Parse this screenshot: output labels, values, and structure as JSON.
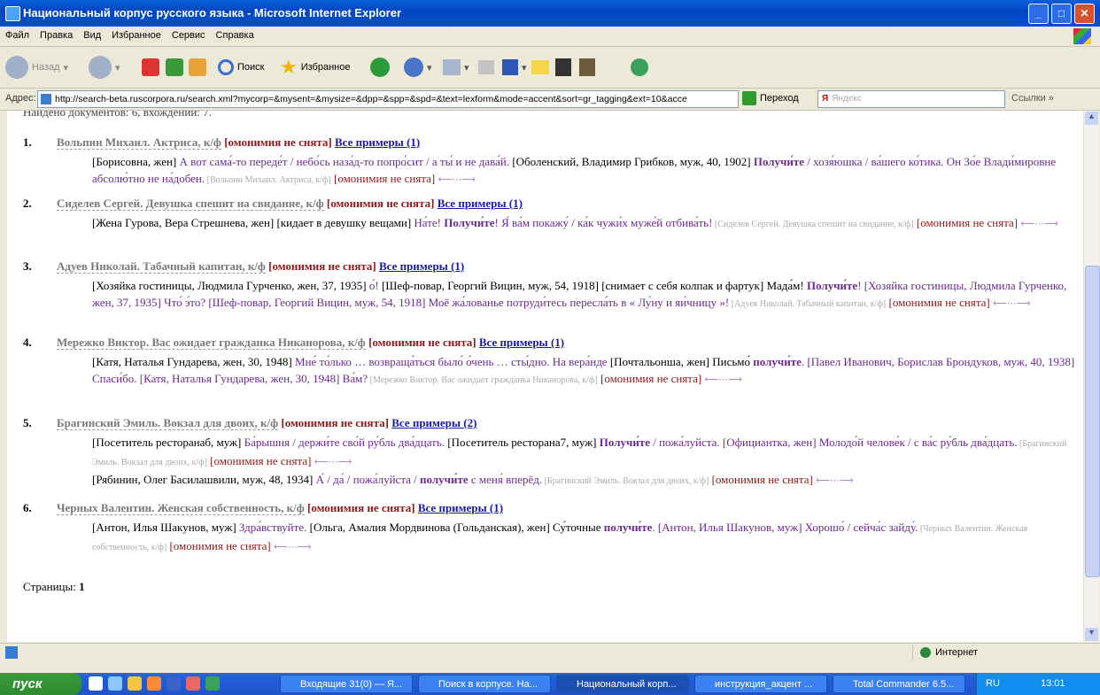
{
  "window": {
    "title": "Национальный корпус русского языка - Microsoft Internet Explorer"
  },
  "menu": [
    "Файл",
    "Правка",
    "Вид",
    "Избранное",
    "Сервис",
    "Справка"
  ],
  "toolbar": {
    "back": "Назад",
    "search": "Поиск",
    "favorites": "Избранное"
  },
  "address": {
    "label": "Адрес:",
    "url": "http://search-beta.ruscorpora.ru/search.xml?mycorp=&mysent=&mysize=&dpp=&spp=&spd=&text=lexform&mode=accent&sort=gr_tagging&ext=10&acce",
    "go": "Переход",
    "yandex_placeholder": "Яндекс",
    "links": "Ссылки"
  },
  "content": {
    "truncated_header": "Найдено документов: 6, вхождений: 7.",
    "homonymy": "[омонимия не снята]",
    "arrows": "⟵⋯⟶",
    "docs": [
      {
        "num": "1.",
        "title": "Вольпин Михаил. Актриса, к/ф",
        "all": "Все примеры (1)",
        "lines": [
          {
            "a": "[Борисовна, жен] ",
            "b": "А вот сама́-то переде́т / небо́сь наза́д-то попро́сит / а ты́ и не дава́й.",
            "c": " [Оболенский, Владимир Грибков, муж, 40, 1902] ",
            "d": "Получи́те",
            "e": " / хозя́юшка / ва́шего ко́тика. Он Зо́е Влади́мировне абсолю́тно не на́добен.",
            "src": " [Вольпин Михаил. Актриса, к/ф]"
          }
        ]
      },
      {
        "num": "2.",
        "title": "Сиделев Сергей. Девушка спешит на свидание, к/ф",
        "all": "Все примеры (1)",
        "lines": [
          {
            "a": "[Жена Гурова, Вера Стрешнева, жен] [кидает в девушку вещами] ",
            "b": "На́те!",
            "c": " ",
            "d": "Получи́те",
            "e": "! Я́ ва́м покажу́ / ка́к чужи́х муже́й отбива́ть!",
            "src": " [Сиделев Сергей. Девушка спешит на свидание, к/ф]"
          }
        ]
      },
      {
        "num": "3.",
        "title": "Адуев Николай. Табачный капитан, к/ф",
        "all": "Все примеры (1)",
        "lines": [
          {
            "a": "[Хозяйка гостиницы, Людмила Гурченко, жен, 37, 1935] ",
            "b": "о́!",
            "c": " [Шеф-повар, Георгий Вицин, муж, 54, 1918] [снимает с себя колпак и фартук] Мада́м! ",
            "d": "Получи́те",
            "e": "! [Хозяйка гостиницы, Людмила Гурченко, жен, 37, 1935] Что́ э́то? [Шеф-повар, Георгий Вицин, муж, 54, 1918] Моё жа́лованье потруди́тесь пересла́ть в « Лу́ну и яи́чницу »!",
            "src": " [Адуев Николай. Табачный капитан, к/ф]"
          }
        ]
      },
      {
        "num": "4.",
        "title": "Мережко Виктор. Вас ожидает гражданка Никанорова, к/ф",
        "all": "Все примеры (1)",
        "lines": [
          {
            "a": "[Катя, Наталья Гундарева, жен, 30, 1948] ",
            "b": "Мне́ то́лько … возвраща́ться было́ о́чень … сты́дно. На вера́нде",
            "c": " [Почтальонша, жен] Письмо́ ",
            "d": "получи́те",
            "e": ". [Павел Иванович, Борислав Брондуков, муж, 40, 1938] Спаси́бо. [Катя, Наталья Гундарева, жен, 30, 1948] Ва́м?",
            "src": " [Мережко Виктор. Вас ожидает гражданка Никанорова, к/ф]"
          }
        ]
      },
      {
        "num": "5.",
        "title": "Брагинский Эмиль. Вокзал для двоих, к/ф",
        "all": "Все примеры (2)",
        "lines": [
          {
            "a": "[Посетитель ресторанаб, муж] ",
            "b": "Ба́рышня / держи́те сво́й ру́бль два́дцать.",
            "c": " [Посетитель ресторана7, муж] ",
            "d": "Получи́те",
            "e": " / пожа́луйста. [Официантка, жен] Молодо́й челове́к / с ва́с ру́бль два́дцать.",
            "src": " [Брагинский Эмиль. Вокзал для двоих, к/ф]"
          },
          {
            "a": "[Рябинин, Олег Басилашвили, муж, 48, 1934] ",
            "b": "А́ / да́ / пожа́луйста /",
            "c": " ",
            "d": "получи́те",
            "e": " с меня́ вперёд.",
            "src": " [Брагинский Эмиль. Вокзал для двоих, к/ф]"
          }
        ]
      },
      {
        "num": "6.",
        "title": "Черных Валентин. Женская собственность, к/ф",
        "all": "Все примеры (1)",
        "lines": [
          {
            "a": "[Антон, Илья Шакунов, муж] ",
            "b": "Здра́вствуйте.",
            "c": " [Ольга, Амалия Мордвинова (Гольданская), жен] Су́точные ",
            "d": "получи́те",
            "e": ". [Антон, Илья Шакунов, муж] Хорошо́ / сейча́с зайду́.",
            "src": " [Черных Валентин. Женская собственность, к/ф]"
          }
        ]
      }
    ],
    "pages_label": "Страницы:",
    "pages_value": "1"
  },
  "status": {
    "zone": "Интернет"
  },
  "taskbar": {
    "start": "пуск",
    "tasks": [
      "Входящие 31(0) — Я...",
      "Поиск в корпусе. На...",
      "Национальный корп...",
      "инструкция_акцент ...",
      "Total Commander 6.5..."
    ],
    "lang": "RU",
    "clock": "13:01"
  },
  "colors": {
    "accent": "#6b2a8e",
    "homonymy": "#8b1a1a",
    "link": "#1a1aa8"
  }
}
